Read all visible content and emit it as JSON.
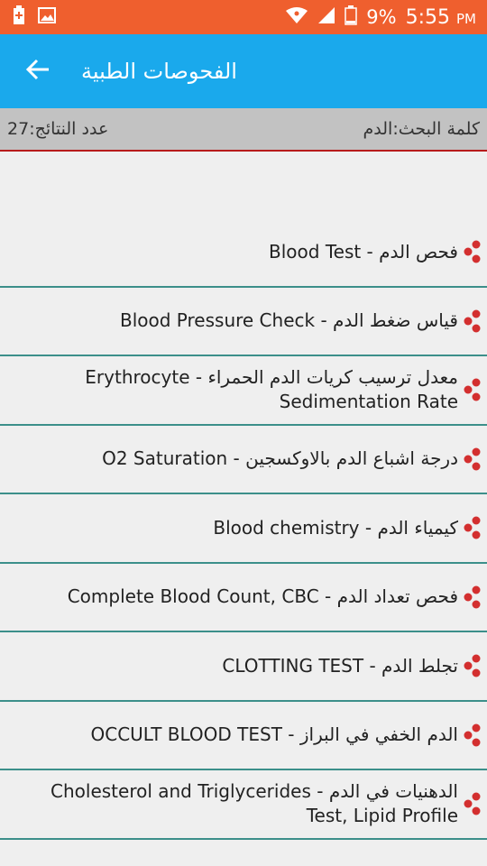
{
  "status_bar": {
    "battery": "9%",
    "time": "5:55",
    "ampm": "PM"
  },
  "app_bar": {
    "title": "الفحوصات الطبية"
  },
  "info_bar": {
    "search_keyword": "كلمة البحث:الدم",
    "results_count": "عدد النتائج:27"
  },
  "list": {
    "items": [
      {
        "label": "فحص الدم  -  Blood Test"
      },
      {
        "label": "قياس ضغط الدم  -  Blood Pressure Check"
      },
      {
        "label": "معدل ترسيب كريات الدم الحمراء  -  Erythrocyte Sedimentation Rate"
      },
      {
        "label": "درجة اشباع الدم بالاوكسجين  -  O2 Saturation"
      },
      {
        "label": "كيمياء الدم  -  Blood chemistry"
      },
      {
        "label": "فحص تعداد الدم  -  Complete Blood Count, CBC"
      },
      {
        "label": "تجلط الدم  -  CLOTTING TEST"
      },
      {
        "label": "الدم الخفي في البراز  -  OCCULT BLOOD TEST"
      },
      {
        "label": "الدهنيات في الدم  -  Cholesterol and Triglycerides Test, Lipid Profile"
      }
    ]
  },
  "colors": {
    "status_bar": "#ef5f2e",
    "app_bar": "#1aa9ec",
    "divider": "#3c8f8a",
    "icon": "#d32f2f"
  }
}
